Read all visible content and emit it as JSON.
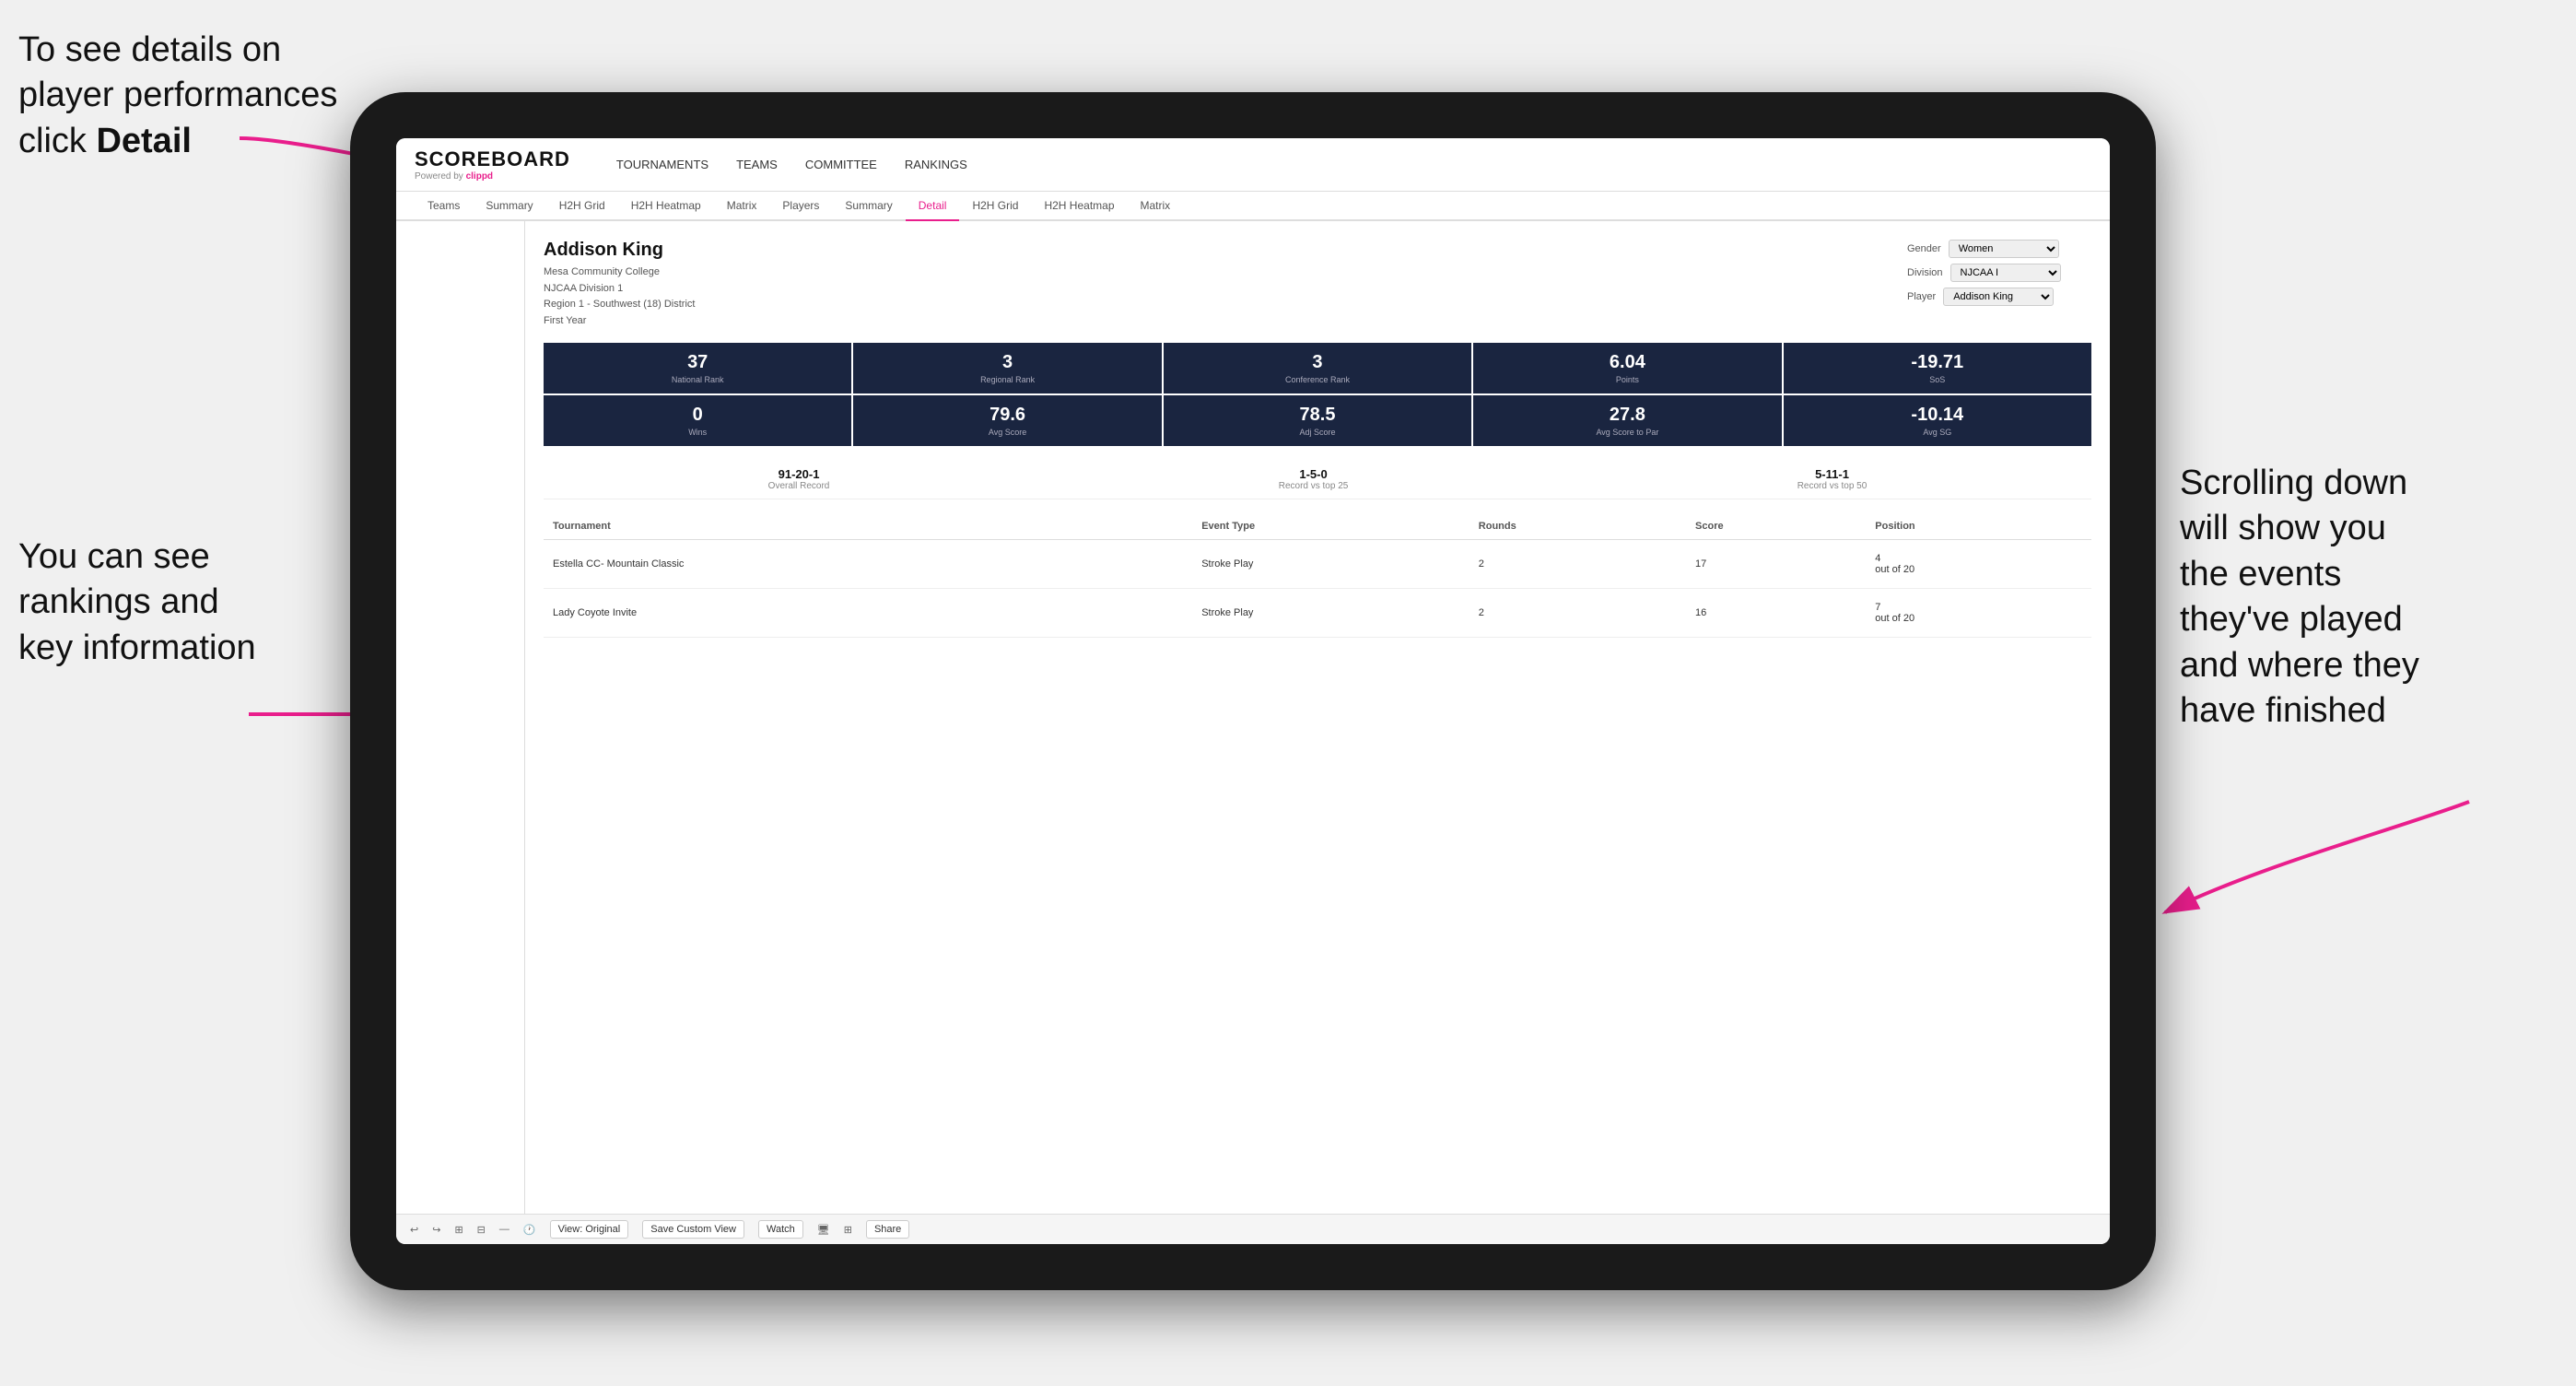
{
  "annotations": {
    "topleft": {
      "line1": "To see details on",
      "line2": "player performances",
      "line3_prefix": "click ",
      "line3_bold": "Detail"
    },
    "bottomleft": {
      "line1": "You can see",
      "line2": "rankings and",
      "line3": "key information"
    },
    "right": {
      "line1": "Scrolling down",
      "line2": "will show you",
      "line3": "the events",
      "line4": "they've played",
      "line5": "and where they",
      "line6": "have finished"
    }
  },
  "nav": {
    "logo": "SCOREBOARD",
    "powered_by": "Powered by ",
    "clippd": "clippd",
    "items": [
      "TOURNAMENTS",
      "TEAMS",
      "COMMITTEE",
      "RANKINGS"
    ]
  },
  "sub_nav": {
    "items": [
      "Teams",
      "Summary",
      "H2H Grid",
      "H2H Heatmap",
      "Matrix",
      "Players",
      "Summary",
      "Detail",
      "H2H Grid",
      "H2H Heatmap",
      "Matrix"
    ],
    "active_index": 7
  },
  "player": {
    "name": "Addison King",
    "school": "Mesa Community College",
    "division": "NJCAA Division 1",
    "region": "Region 1 - Southwest (18) District",
    "year": "First Year"
  },
  "selectors": {
    "gender_label": "Gender",
    "gender_value": "Women",
    "division_label": "Division",
    "division_value": "NJCAA I",
    "player_label": "Player",
    "player_value": "Addison King"
  },
  "stats_row1": [
    {
      "value": "37",
      "label": "National Rank"
    },
    {
      "value": "3",
      "label": "Regional Rank"
    },
    {
      "value": "3",
      "label": "Conference Rank"
    },
    {
      "value": "6.04",
      "label": "Points"
    },
    {
      "value": "-19.71",
      "label": "SoS"
    }
  ],
  "stats_row2": [
    {
      "value": "0",
      "label": "Wins"
    },
    {
      "value": "79.6",
      "label": "Avg Score"
    },
    {
      "value": "78.5",
      "label": "Adj Score"
    },
    {
      "value": "27.8",
      "label": "Avg Score to Par"
    },
    {
      "value": "-10.14",
      "label": "Avg SG"
    }
  ],
  "records": [
    {
      "value": "91-20-1",
      "label": "Overall Record"
    },
    {
      "value": "1-5-0",
      "label": "Record vs top 25"
    },
    {
      "value": "5-11-1",
      "label": "Record vs top 50"
    }
  ],
  "table": {
    "headers": [
      "Tournament",
      "",
      "Event Type",
      "Rounds",
      "Score",
      "Position"
    ],
    "rows": [
      {
        "tournament": "Estella CC- Mountain Classic",
        "event_type": "Stroke Play",
        "rounds": "2",
        "score": "17",
        "position": "4\nout of 20"
      },
      {
        "tournament": "Lady Coyote Invite",
        "event_type": "Stroke Play",
        "rounds": "2",
        "score": "16",
        "position": "7\nout of 20"
      }
    ]
  },
  "toolbar": {
    "view_label": "View: Original",
    "save_label": "Save Custom View",
    "watch_label": "Watch",
    "share_label": "Share"
  }
}
